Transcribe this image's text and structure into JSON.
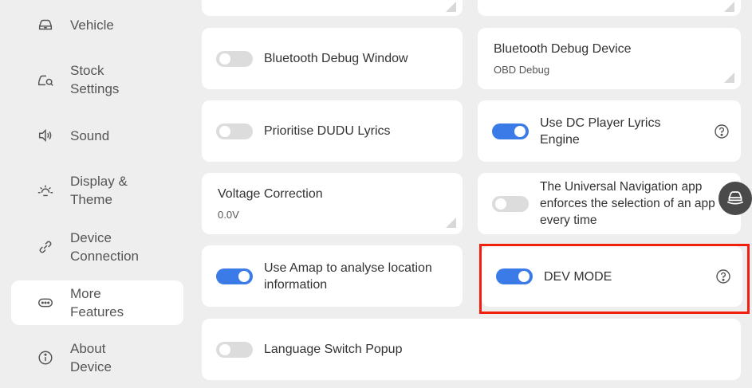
{
  "sidebar": {
    "items": [
      {
        "label": "Vehicle",
        "icon": "car-icon",
        "active": false
      },
      {
        "label": "Stock\nSettings",
        "icon": "stock-settings-icon",
        "active": false
      },
      {
        "label": "Sound",
        "icon": "speaker-icon",
        "active": false
      },
      {
        "label": "Display &\nTheme",
        "icon": "sun-icon",
        "active": false
      },
      {
        "label": "Device\nConnection",
        "icon": "link-icon",
        "active": false
      },
      {
        "label": "More\nFeatures",
        "icon": "more-icon",
        "active": true
      },
      {
        "label": "About\nDevice",
        "icon": "info-icon",
        "active": false
      }
    ]
  },
  "settings": {
    "bluetooth_debug_window": {
      "label": "Bluetooth Debug Window",
      "enabled": false
    },
    "bluetooth_debug_device": {
      "title": "Bluetooth Debug Device",
      "value": "OBD Debug"
    },
    "prioritise_dudu_lyrics": {
      "label": "Prioritise DUDU Lyrics",
      "enabled": false
    },
    "dc_player_lyrics": {
      "label": "Use DC Player Lyrics Engine",
      "enabled": true
    },
    "voltage_correction": {
      "title": "Voltage Correction",
      "value": "0.0V"
    },
    "universal_navigation": {
      "label": "The Universal Navigation app enforces the selection of an app every time",
      "enabled": false
    },
    "amap_location": {
      "label": "Use Amap to analyse location information",
      "enabled": true
    },
    "dev_mode": {
      "label": "DEV MODE",
      "enabled": true
    },
    "language_switch_popup": {
      "label": "Language Switch Popup",
      "enabled": false
    }
  },
  "colors": {
    "accent": "#3b7be8",
    "highlight": "#f21e0e",
    "background": "#eeeeee"
  }
}
